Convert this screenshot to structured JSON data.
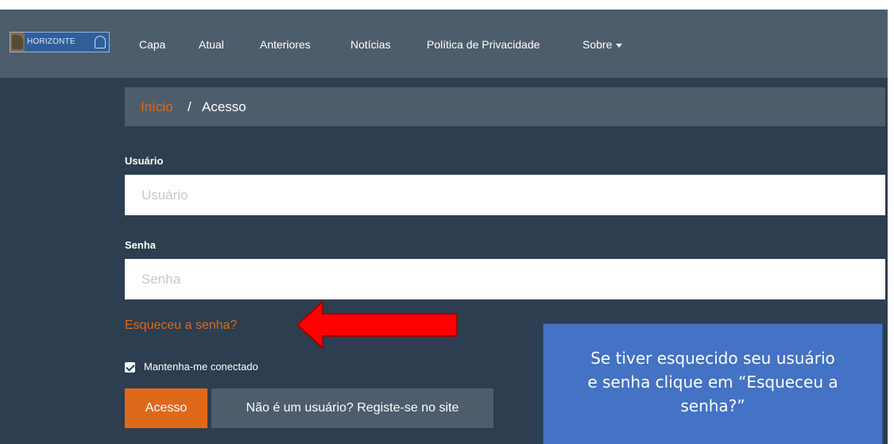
{
  "logo": {
    "text": "HORIZONTE"
  },
  "nav": {
    "items": [
      "Capa",
      "Atual",
      "Anteriores",
      "Notícias",
      "Política de Privacidade"
    ],
    "dropdown_label": "Sobre"
  },
  "breadcrumb": {
    "home": "Início",
    "separator": "/",
    "current": "Acesso"
  },
  "form": {
    "username_label": "Usuário",
    "username_placeholder": "Usuário",
    "password_label": "Senha",
    "password_placeholder": "Senha",
    "forgot_link": "Esqueceu a senha?",
    "remember_label": "Mantenha-me conectado",
    "remember_checked": true,
    "login_button": "Acesso",
    "register_button": "Não é um usuário? Registe-se no site"
  },
  "annotation": {
    "callout_lines": [
      "Se tiver esquecido seu usuário",
      "e senha clique em “Esqueceu a",
      "senha?”"
    ],
    "arrow_color": "#ff0000",
    "callout_color": "#4472c4"
  },
  "colors": {
    "accent": "#df691a",
    "navbar": "#4e5d6c",
    "background": "#2c3e50"
  }
}
